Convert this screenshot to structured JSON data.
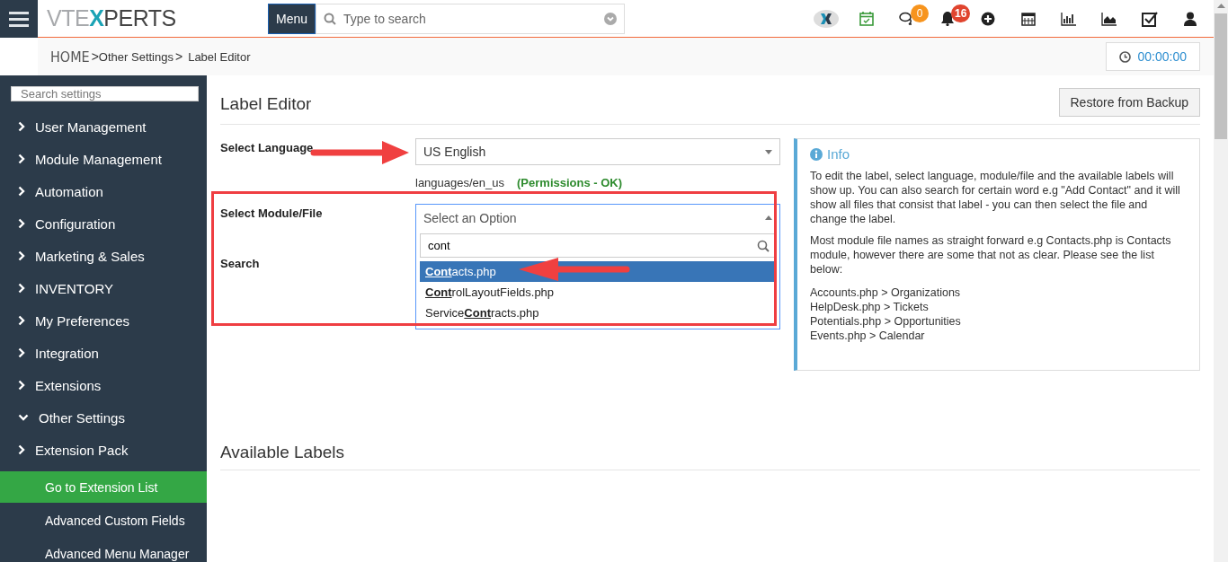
{
  "header": {
    "logo": [
      "VTE",
      "X",
      "PERTS"
    ],
    "menu_button": "Menu",
    "search": {
      "placeholder": "Type to search"
    },
    "chat_badge": "0",
    "alert_badge": "16"
  },
  "breadcrumb": {
    "items": [
      "HOME",
      "Other Settings",
      "Label Editor"
    ],
    "separator": ">"
  },
  "timer": "00:00:00",
  "sidebar": {
    "search": {
      "placeholder": "Search settings"
    },
    "items": [
      {
        "label": "User Management",
        "expanded": false
      },
      {
        "label": "Module Management",
        "expanded": false
      },
      {
        "label": "Automation",
        "expanded": false
      },
      {
        "label": "Configuration",
        "expanded": false
      },
      {
        "label": "Marketing & Sales",
        "expanded": false
      },
      {
        "label": "INVENTORY",
        "expanded": false
      },
      {
        "label": "My Preferences",
        "expanded": false
      },
      {
        "label": "Integration",
        "expanded": false
      },
      {
        "label": "Extensions",
        "expanded": false
      },
      {
        "label": "Other Settings",
        "expanded": true
      },
      {
        "label": "Extension Pack",
        "expanded": false,
        "children": [
          {
            "label": "Go to Extension List",
            "selected": true
          },
          {
            "label": "Advanced Custom Fields",
            "selected": false
          },
          {
            "label": "Advanced Menu Manager",
            "selected": false
          }
        ]
      }
    ]
  },
  "page": {
    "title": "Label Editor",
    "restore_button": "Restore from Backup",
    "language": {
      "label": "Select Language",
      "value": "US English",
      "path": "languages/en_us",
      "status": "(Permissions - OK)"
    },
    "module": {
      "label": "Select Module/File",
      "placeholder": "Select an Option",
      "expanded": true,
      "filter": "cont",
      "options": [
        {
          "label": "**Cont**acts.php",
          "selected": true
        },
        {
          "label": "**Cont**rolLayoutFields.php",
          "selected": false
        },
        {
          "label": "Service**Cont**racts.php",
          "selected": false
        }
      ]
    },
    "search_label": "Search",
    "info": {
      "title": "Info",
      "paragraphs": [
        "To edit the label, select language, module/file and the available labels will show up. You can also search for certain word e.g \"Add Contact\" and it will show all files that consist that label - you can then select the file and change the label.",
        "Most module file names as straight forward e.g Contacts.php is Contacts module, however there are some that not as clear. Please see the list below:"
      ],
      "mappings": [
        "Accounts.php > Organizations",
        "HelpDesk.php > Tickets",
        "Potentials.php > Opportunities",
        "Events.php > Calendar"
      ]
    },
    "section_title": "Available Labels"
  }
}
